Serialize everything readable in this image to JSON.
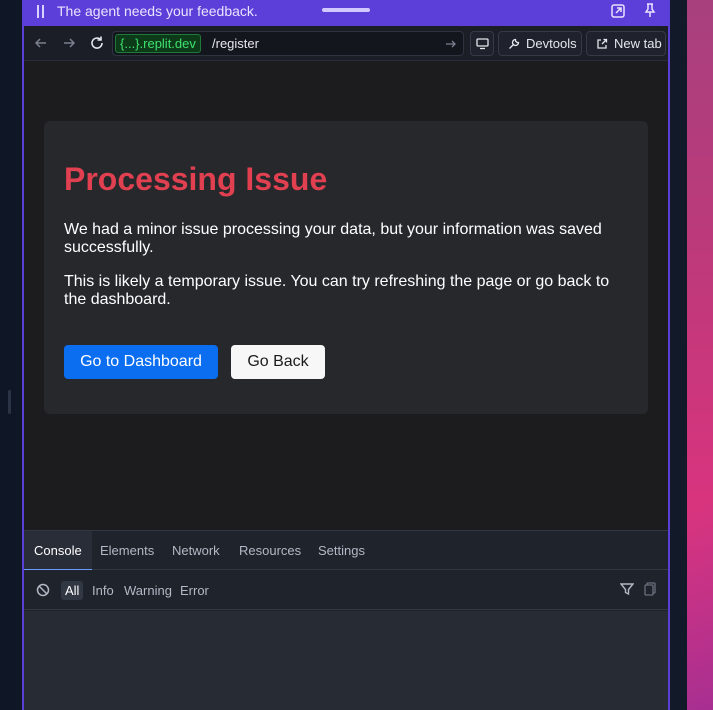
{
  "feedback_bar": {
    "message": "The agent needs your feedback.",
    "accent": "#5b3fd8"
  },
  "nav": {
    "url_domain": "{...}.replit.dev",
    "url_path": "/register",
    "devtools_label": "Devtools",
    "newtab_label": "New tab"
  },
  "card": {
    "title": "Processing Issue",
    "paragraph1": "We had a minor issue processing your data, but your information was saved successfully.",
    "paragraph2": "This is likely a temporary issue. You can try refreshing the page or go back to the dashboard.",
    "primary_button": "Go to Dashboard",
    "secondary_button": "Go Back",
    "title_color": "#e04050",
    "primary_color": "#0b6ef0"
  },
  "devtools": {
    "tabs": [
      {
        "label": "Console",
        "active": true
      },
      {
        "label": "Elements",
        "active": false
      },
      {
        "label": "Network",
        "active": false
      },
      {
        "label": "Resources",
        "active": false
      },
      {
        "label": "Settings",
        "active": false
      }
    ],
    "filters": [
      {
        "label": "All",
        "active": true
      },
      {
        "label": "Info",
        "active": false
      },
      {
        "label": "Warning",
        "active": false
      },
      {
        "label": "Error",
        "active": false
      }
    ]
  },
  "icons": [
    "pause-icon",
    "popout-icon",
    "pin-icon",
    "back-arrow-icon",
    "forward-arrow-icon",
    "reload-icon",
    "go-arrow-icon",
    "screen-icon",
    "wrench-icon",
    "external-link-icon",
    "clear-console-icon",
    "funnel-icon",
    "trash-icon"
  ]
}
